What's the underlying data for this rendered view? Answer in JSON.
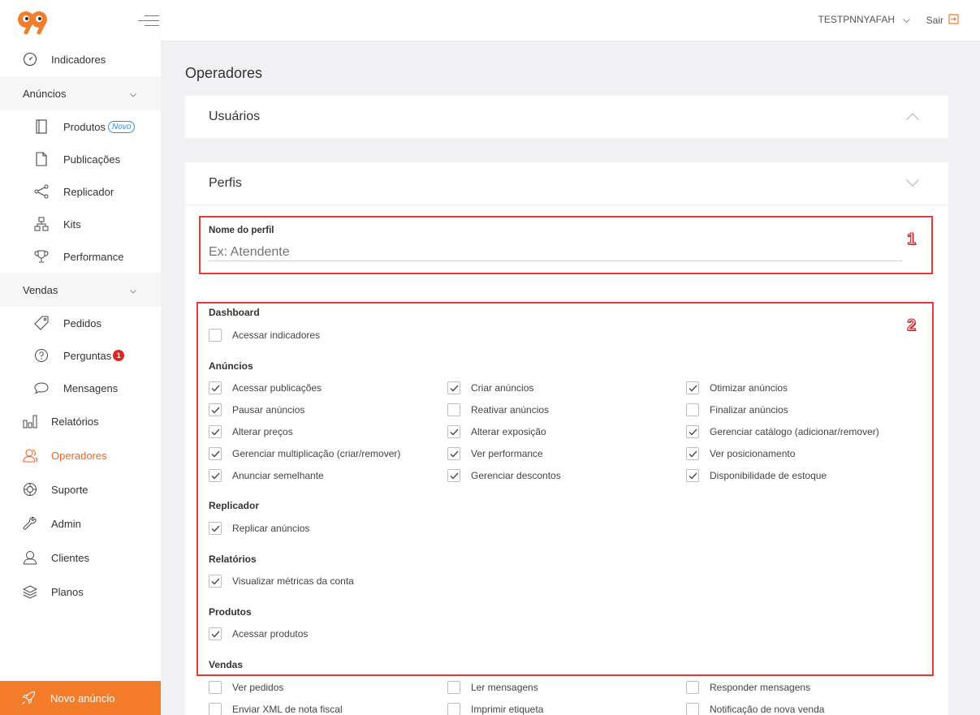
{
  "app": {
    "brand_color": "#f26322",
    "accent_blue": "#2b8de8"
  },
  "topbar": {
    "user_name": "TESTPNNYAFAH",
    "logout_label": "Sair"
  },
  "sidebar": {
    "indicadores": "Indicadores",
    "anuncios_group": "Anúncios",
    "produtos": "Produtos",
    "produtos_badge": "Novo",
    "publicacoes": "Publicações",
    "replicador": "Replicador",
    "kits": "Kits",
    "performance": "Performance",
    "vendas_group": "Vendas",
    "pedidos": "Pedidos",
    "perguntas": "Perguntas",
    "perguntas_count": "1",
    "mensagens": "Mensagens",
    "relatorios": "Relatórios",
    "operadores": "Operadores",
    "suporte": "Suporte",
    "admin": "Admin",
    "clientes": "Clientes",
    "planos": "Planos",
    "novo_anuncio": "Novo anúncio"
  },
  "main": {
    "page_title": "Operadores",
    "usuarios_title": "Usuários",
    "perfis_title": "Perfis",
    "profile_name_label": "Nome do perfil",
    "profile_name_placeholder": "Ex: Atendente",
    "marker_1": "1",
    "marker_2": "2"
  },
  "permissions": {
    "dashboard": {
      "title": "Dashboard",
      "items": [
        {
          "label": "Acessar indicadores",
          "checked": false
        }
      ]
    },
    "anuncios": {
      "title": "Anúncios",
      "items": [
        {
          "label": "Acessar publicações",
          "checked": true
        },
        {
          "label": "Criar anúncios",
          "checked": true
        },
        {
          "label": "Otimizar anúncios",
          "checked": true
        },
        {
          "label": "Pausar anúncios",
          "checked": true
        },
        {
          "label": "Reativar anúncios",
          "checked": false
        },
        {
          "label": "Finalizar anúncios",
          "checked": false
        },
        {
          "label": "Alterar preços",
          "checked": true
        },
        {
          "label": "Alterar exposição",
          "checked": true
        },
        {
          "label": "Gerenciar catálogo (adicionar/remover)",
          "checked": true
        },
        {
          "label": "Gerenciar multiplicação (criar/remover)",
          "checked": true
        },
        {
          "label": "Ver performance",
          "checked": true
        },
        {
          "label": "Ver posicionamento",
          "checked": true
        },
        {
          "label": "Anunciar semelhante",
          "checked": true
        },
        {
          "label": "Gerenciar descontos",
          "checked": true
        },
        {
          "label": "Disponibilidade de estoque",
          "checked": true
        }
      ]
    },
    "replicador": {
      "title": "Replicador",
      "items": [
        {
          "label": "Replicar anúncios",
          "checked": true
        }
      ]
    },
    "relatorios": {
      "title": "Relatórios",
      "items": [
        {
          "label": "Visualizar métricas da conta",
          "checked": true
        }
      ]
    },
    "produtos": {
      "title": "Produtos",
      "items": [
        {
          "label": "Acessar produtos",
          "checked": true
        }
      ]
    },
    "vendas": {
      "title": "Vendas",
      "items": [
        {
          "label": "Ver pedidos",
          "checked": false
        },
        {
          "label": "Ler mensagens",
          "checked": false
        },
        {
          "label": "Responder mensagens",
          "checked": false
        },
        {
          "label": "Enviar XML de nota fiscal",
          "checked": false
        },
        {
          "label": "Imprimir etiqueta",
          "checked": false
        },
        {
          "label": "Notificação de nova venda",
          "checked": false
        }
      ]
    }
  }
}
